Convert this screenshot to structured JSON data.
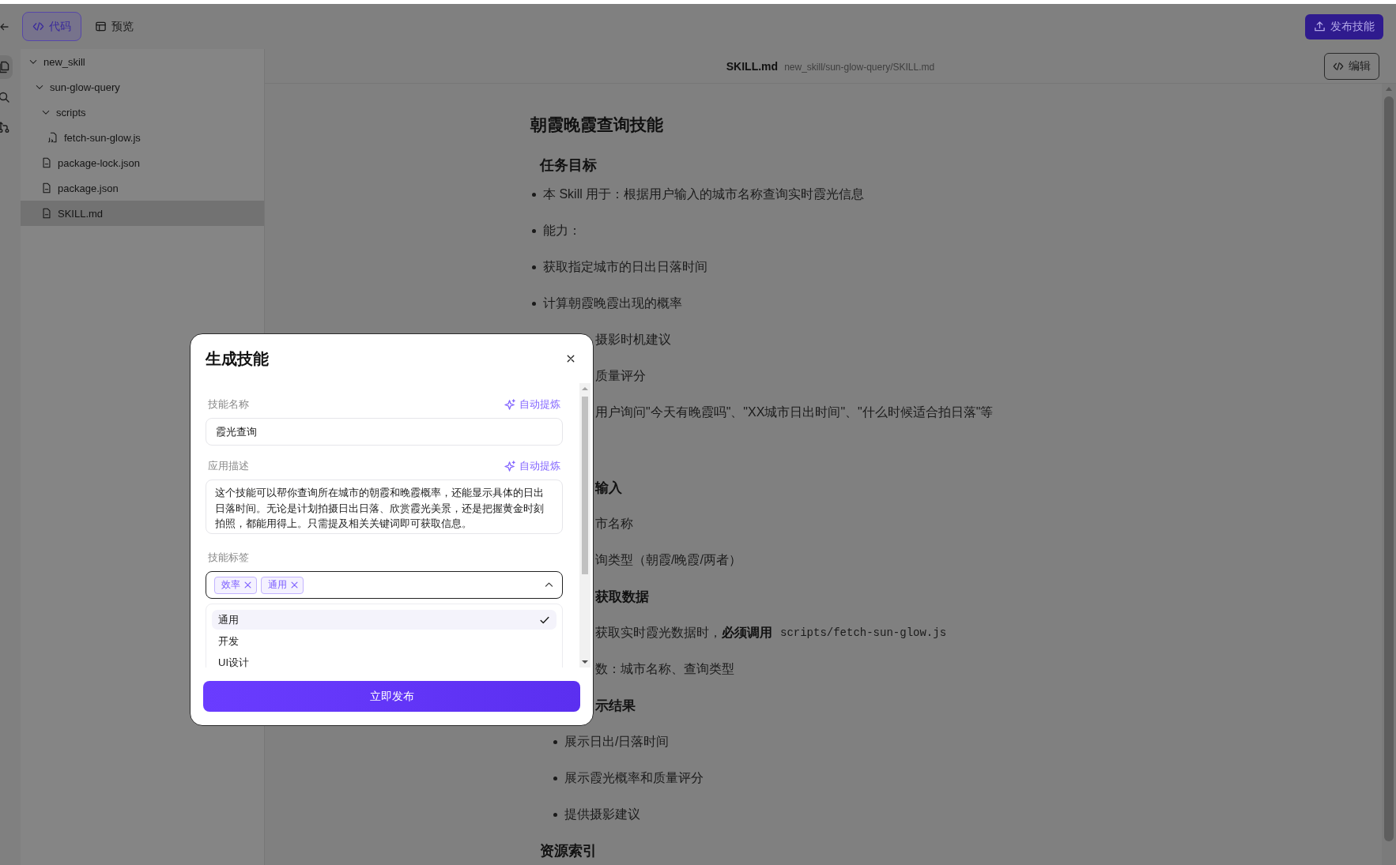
{
  "header": {
    "tabs": [
      {
        "label": "代码",
        "selected": true
      },
      {
        "label": "预览",
        "selected": false
      }
    ],
    "publish_button": "发布技能"
  },
  "rail": [
    {
      "selected": true
    },
    {
      "selected": false
    },
    {
      "selected": false
    }
  ],
  "file_tree": [
    {
      "name": "new_skill",
      "kind": "folder",
      "expanded": true,
      "selected": false,
      "children": [
        {
          "name": "sun-glow-query",
          "kind": "folder",
          "expanded": true,
          "selected": false,
          "children": [
            {
              "name": "scripts",
              "kind": "folder",
              "expanded": true,
              "selected": false,
              "children": [
                {
                  "name": "fetch-sun-glow.js",
                  "kind": "script",
                  "selected": false
                }
              ]
            },
            {
              "name": "package-lock.json",
              "kind": "file",
              "selected": false
            },
            {
              "name": "package.json",
              "kind": "file",
              "selected": false
            },
            {
              "name": "SKILL.md",
              "kind": "file",
              "selected": true
            }
          ]
        }
      ]
    }
  ],
  "main": {
    "file_name": "SKILL.md",
    "file_path": "new_skill/sun-glow-query/SKILL.md",
    "edit_button": "编辑",
    "title": "朝霞晚霞查询技能",
    "sections": [
      {
        "heading": "任务目标",
        "items": [
          {
            "kind": "bullet",
            "text": "本 Skill 用于：根据用户输入的城市名称查询实时霞光信息",
            "clipped": false
          },
          {
            "kind": "bullet",
            "text": "能力：",
            "clipped": false
          },
          {
            "kind": "bullet",
            "text": "获取指定城市的日出日落时间",
            "clipped": false
          },
          {
            "kind": "bullet",
            "text": "计算朝霞晚霞出现的概率",
            "clipped": false
          },
          {
            "kind": "bullet",
            "text": "摄影时机建议",
            "clipped": true
          },
          {
            "kind": "bullet",
            "text": "质量评分",
            "clipped": true
          },
          {
            "kind": "bullet",
            "text": "用户询问\"今天有晚霞吗\"、\"XX城市日出时间\"、\"什么时候适合拍日落\"等",
            "clipped": true
          }
        ]
      },
      {
        "items": [
          {
            "kind": "h3",
            "text": "输入",
            "clipped": true
          },
          {
            "kind": "bullet",
            "text": "市名称",
            "clipped": true
          },
          {
            "kind": "bullet",
            "text": "询类型（朝霞/晚霞/两者）",
            "clipped": true
          },
          {
            "kind": "h3",
            "text": "获取数据",
            "clipped": true
          },
          {
            "kind": "bullet",
            "text": "获取实时霞光数据时，",
            "bold": "必须调用",
            "code": "scripts/fetch-sun-glow.js",
            "clipped": true
          },
          {
            "kind": "bullet",
            "text": "数：城市名称、查询类型",
            "clipped": true
          },
          {
            "kind": "h3",
            "text": "示结果",
            "clipped": true
          },
          {
            "kind": "subbullet",
            "text": "展示日出/日落时间",
            "clipped": false
          },
          {
            "kind": "subbullet",
            "text": "展示霞光概率和质量评分",
            "clipped": false
          },
          {
            "kind": "subbullet",
            "text": "提供摄影建议",
            "clipped": false
          }
        ]
      },
      {
        "heading": "资源索引"
      }
    ]
  },
  "dialog": {
    "title": "生成技能",
    "fields": [
      {
        "kind": "input",
        "label": "技能名称",
        "action": "自动提炼",
        "value": "霞光查询"
      },
      {
        "kind": "textarea",
        "label": "应用描述",
        "action": "自动提炼",
        "value": "这个技能可以帮你查询所在城市的朝霞和晚霞概率，还能显示具体的日出日落时间。无论是计划拍摄日出日落、欣赏霞光美景，还是把握黄金时刻拍照，都能用得上。只需提及相关关键词即可获取信息。"
      },
      {
        "kind": "tags",
        "label": "技能标签",
        "tags": [
          "效率",
          "通用"
        ],
        "expanded": true,
        "options": [
          {
            "label": "通用",
            "selected": true
          },
          {
            "label": "开发",
            "selected": false
          },
          {
            "label": "UI设计",
            "selected": false
          }
        ]
      }
    ],
    "submit_button": "立即发布"
  }
}
